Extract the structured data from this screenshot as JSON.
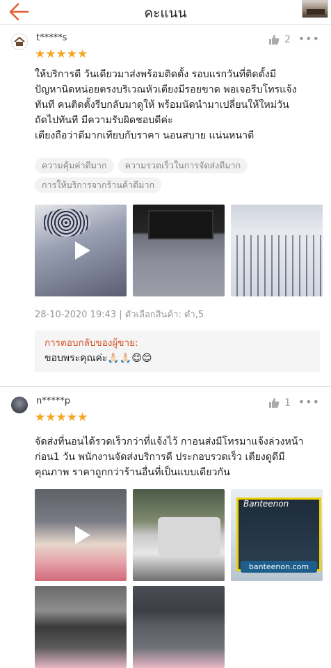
{
  "header": {
    "title": "คะแนน",
    "back_icon": "arrow-left-icon",
    "accent": "#e15f35"
  },
  "reviews": [
    {
      "username": "t*****s",
      "stars": "★★★★★",
      "likes": "2",
      "text_lines": [
        "ให้บริการดี วันเดียวมาส่งพร้อมติดตั้ง รอบแรกวันที่ติดตั้งมี",
        "ปัญหานิดหน่อยตรงบริเวณหัวเตียงมีรอยขาด พอเจอรีบโทรแจ้ง",
        "ทันที คนติดตั้งรีบกลับมาดูให้ พร้อมนัดนำมาเปลี่ยนให้ใหม่วัน",
        "ถัดไปทันที มีความรับผิดชอบดีค่ะ",
        "เตียงถือว่าดีมากเทียบกับราคา นอนสบาย แน่นหนาดี"
      ],
      "tags": [
        "ความคุ้มค่าดีมาก",
        "ความรวดเร็วในการจัดส่งดีมาก",
        "การให้บริการจากร้านค้าดีมาก"
      ],
      "meta": "28-10-2020 19:43 | ตัวเลือกสินค้า: ดำ,5",
      "seller_reply_title": "การตอบกลับของผู้ขาย:",
      "seller_reply_text": "ขอบพระคุณค่ะ🙏🏻🙏🏻😊😊"
    },
    {
      "username": "n*****p",
      "stars": "★★★★★",
      "likes": "1",
      "text_lines": [
        "จัดส่งที่นอนได้รวดเร็วกว่าที่แจ้งไว้ กาอนส่งมีโทรมาแจ้งล่วงหน้า",
        "ก่อน1 วัน พนักงานจัดส่งบริการดี ประกอบรวดเร็ว เตียงดูดีมี",
        "คุณภาพ ราคาถูกกว่าร้านอื่นที่เป็นแบบเดียวกัน"
      ],
      "photo_brand": "Banteenon",
      "photo_caption": "banteenon.com"
    }
  ],
  "star_color": "#f5a623",
  "seller_reply_color": "#d4552a"
}
